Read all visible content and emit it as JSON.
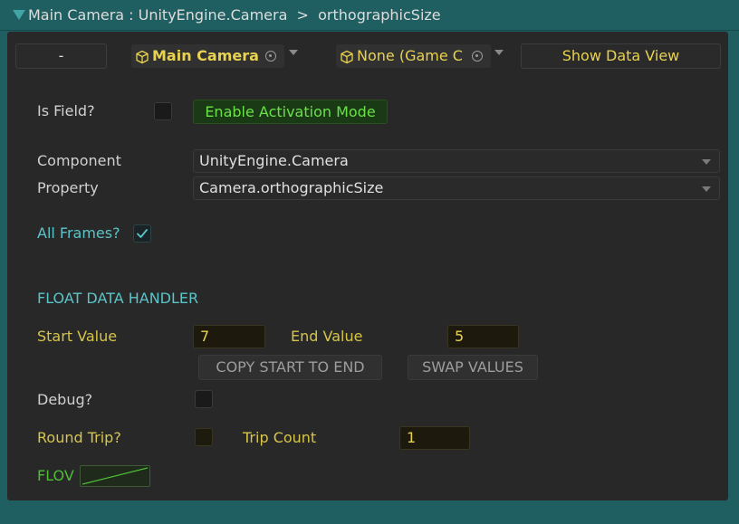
{
  "header": {
    "title": "Main Camera : UnityEngine.Camera  >  orthographicSize"
  },
  "toolbar": {
    "minus_label": "-",
    "target_object": "Main Camera",
    "secondary_object": "None (Game C",
    "show_data_view_label": "Show Data View"
  },
  "fields": {
    "is_field_label": "Is Field?",
    "enable_activation_label": "Enable Activation Mode",
    "component_label": "Component",
    "component_value": "UnityEngine.Camera",
    "property_label": "Property",
    "property_value": "Camera.orthographicSize",
    "all_frames_label": "All Frames?"
  },
  "float_handler": {
    "section_title": "FLOAT DATA HANDLER",
    "start_label": "Start Value",
    "start_value": "7",
    "end_label": "End Value",
    "end_value": "5",
    "copy_button": "COPY START TO END",
    "swap_button": "SWAP VALUES",
    "debug_label": "Debug?",
    "round_trip_label": "Round Trip?",
    "trip_count_label": "Trip Count",
    "trip_count_value": "1",
    "flow_label": "FLOV"
  },
  "colors": {
    "header_bg": "#1f5f62",
    "panel_bg": "#282828",
    "accent_cyan": "#5bc4c8",
    "accent_yellow": "#e9d24f",
    "accent_green": "#4cbf34"
  }
}
